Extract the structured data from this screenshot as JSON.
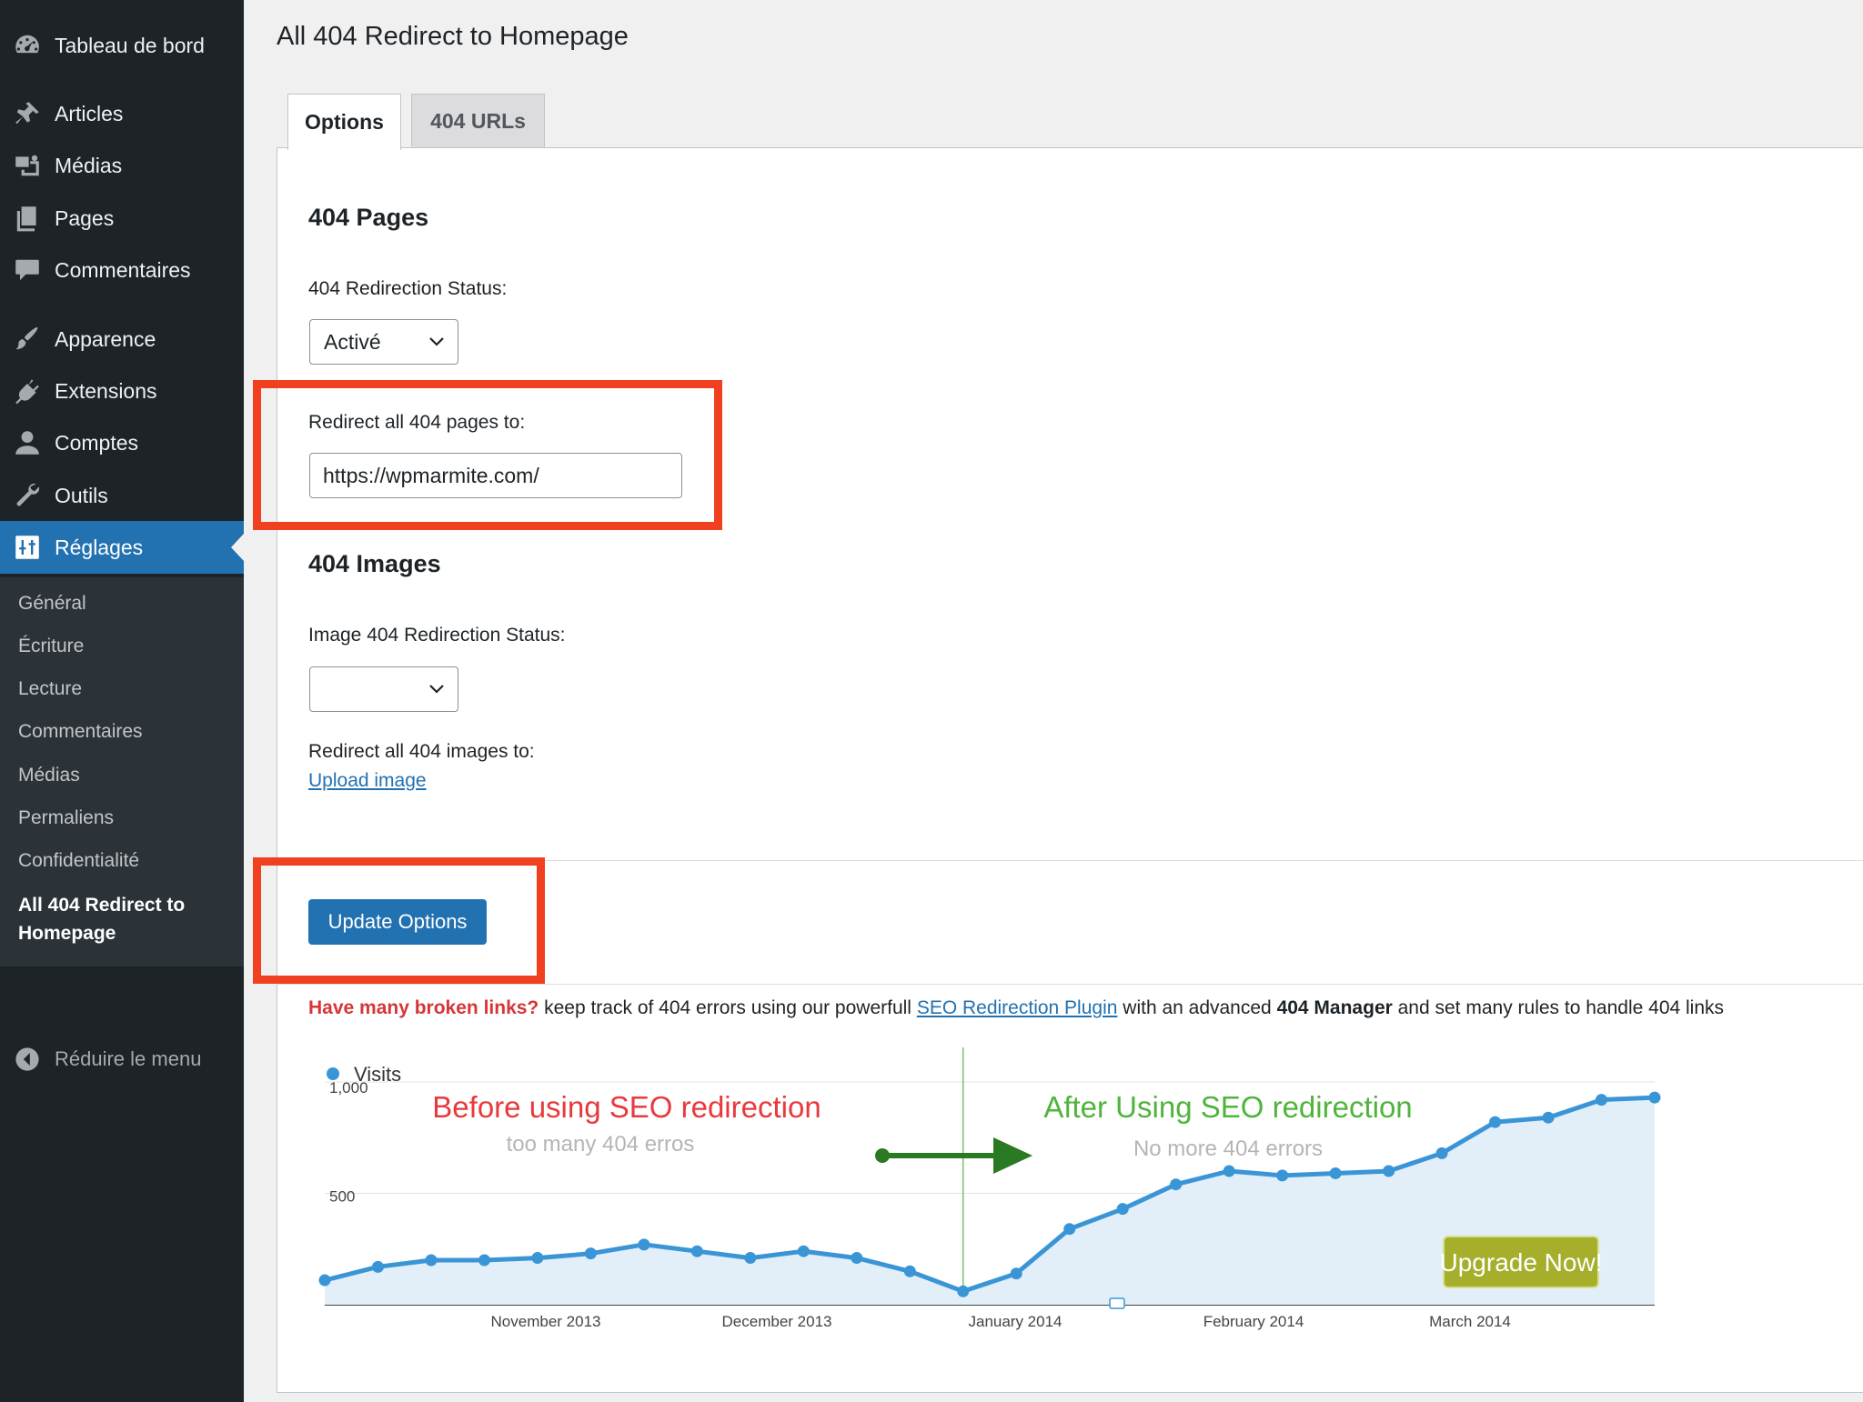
{
  "sidebar": {
    "dashboard": "Tableau de bord",
    "items": [
      "Articles",
      "Médias",
      "Pages",
      "Commentaires",
      "Apparence",
      "Extensions",
      "Comptes",
      "Outils"
    ],
    "active": "Réglages",
    "submenu": [
      "Général",
      "Écriture",
      "Lecture",
      "Commentaires",
      "Médias",
      "Permaliens",
      "Confidentialité"
    ],
    "submenu_current": "All 404 Redirect to Homepage",
    "collapse": "Réduire le menu"
  },
  "page": {
    "title": "All 404 Redirect to Homepage",
    "tabs": [
      "Options",
      "404 URLs"
    ]
  },
  "pages_section": {
    "heading": "404 Pages",
    "status_label": "404 Redirection Status:",
    "status_value": "Activé",
    "redirect_label": "Redirect all 404 pages to:",
    "redirect_value": "https://wpmarmite.com/"
  },
  "images_section": {
    "heading": "404 Images",
    "status_label": "Image 404 Redirection Status:",
    "status_value": "",
    "redirect_label": "Redirect all 404 images to:",
    "upload_link": "Upload image"
  },
  "update_button": "Update Options",
  "promo": {
    "lead": "Have many broken links?",
    "text1": " keep track of 404 errors using our powerfull ",
    "link": "SEO Redirection Plugin",
    "text2": " with an advanced ",
    "bold": "404 Manager",
    "text3": " and set many rules to handle 404 links"
  },
  "chart_data": {
    "type": "area",
    "title": "",
    "legend": [
      "Visits"
    ],
    "ylim": [
      0,
      1000
    ],
    "yticks": [
      "1,000",
      "500"
    ],
    "xticks": [
      "November 2013",
      "December 2013",
      "January 2014",
      "February 2014",
      "March 2014"
    ],
    "series": [
      {
        "name": "Visits",
        "values": [
          110,
          170,
          200,
          200,
          210,
          230,
          270,
          240,
          210,
          240,
          210,
          150,
          60,
          140,
          340,
          430,
          540,
          600,
          580,
          590,
          600,
          680,
          820,
          840,
          920,
          930
        ]
      }
    ],
    "annotations": {
      "before_title": "Before using SEO redirection",
      "before_sub": "too many 404 erros",
      "after_title": "After Using SEO redirection",
      "after_sub": "No more 404 errors",
      "upgrade": "Upgrade Now!"
    },
    "colors": {
      "line": "#3a95d6",
      "area": "#e2eff9",
      "before": "#e8393d",
      "after": "#4fb43c",
      "arrow": "#2a7a24",
      "upgrade_bg": "#a5af2b"
    }
  },
  "colors": {
    "sidebar": "#1d2327",
    "submenu": "#2c3338",
    "accent": "#2271b1",
    "highlight": "#f1401f"
  }
}
